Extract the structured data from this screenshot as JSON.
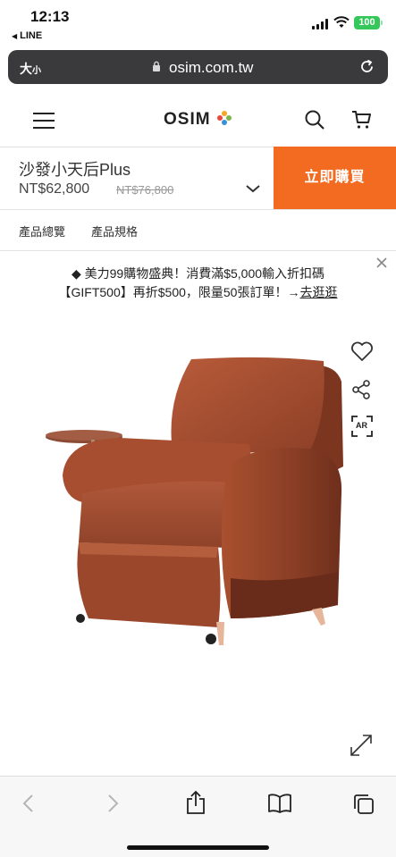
{
  "status_bar": {
    "time": "12:13",
    "back_app": "LINE",
    "battery": "100"
  },
  "browser": {
    "text_size": "大",
    "text_size_small": "小",
    "url": "osim.com.tw"
  },
  "header": {
    "logo": "OSIM"
  },
  "product": {
    "name": "沙發小天后Plus",
    "price": "NT$62,800",
    "original_price": "NT$76,800",
    "buy_label": "立即購買"
  },
  "tabs": [
    {
      "label": "產品總覽"
    },
    {
      "label": "產品規格"
    }
  ],
  "promo": {
    "line1": "◆ 美力99購物盛典！消費滿$5,000輸入折扣碼",
    "line2": "【GIFT500】再折$500，限量50張訂單！→",
    "link": "去逛逛"
  },
  "image_actions": {
    "ar_label": "AR"
  },
  "colors": {
    "accent": "#f26b21",
    "chair": "#9a4a2e",
    "battery": "#34c759"
  }
}
